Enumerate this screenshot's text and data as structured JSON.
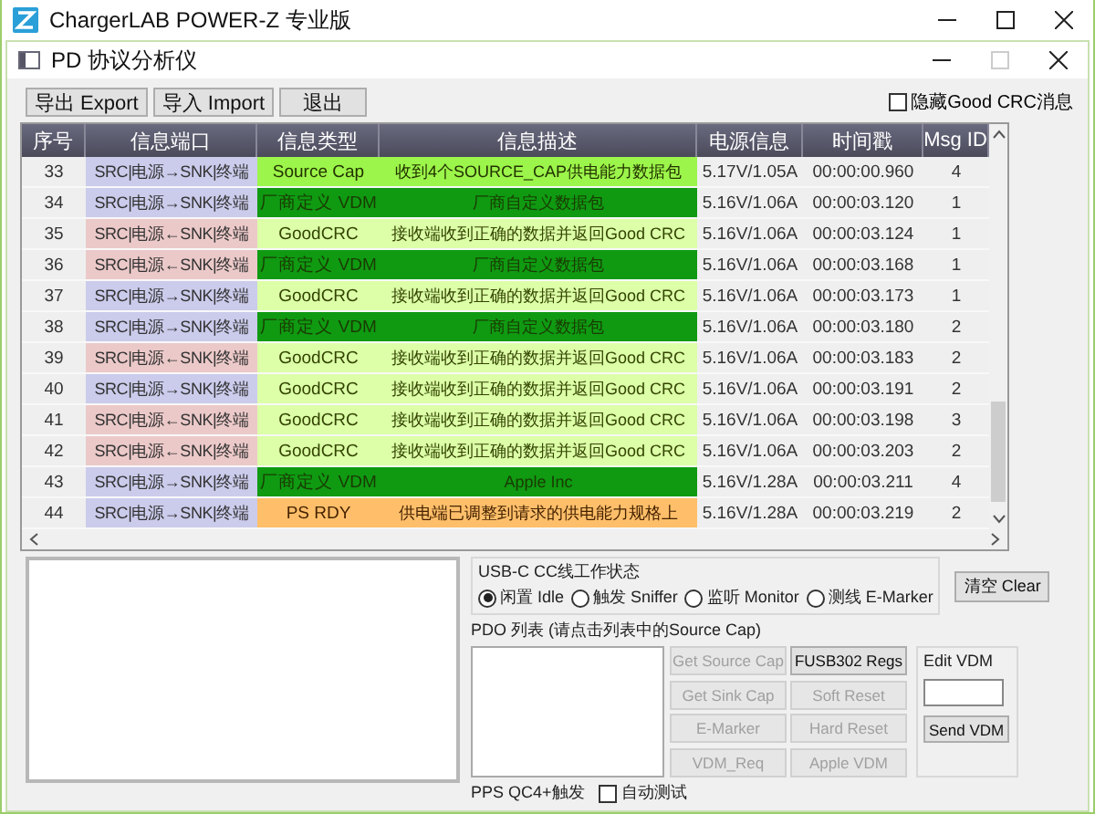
{
  "app_window": {
    "title": "ChargerLAB POWER-Z 专业版"
  },
  "dialog": {
    "title": "PD 协议分析仪"
  },
  "toolbar": {
    "buttons": [
      "导出 Export",
      "导入 Import",
      "退出"
    ],
    "hide_crc": {
      "label": "隐藏Good CRC消息",
      "checked": false
    }
  },
  "table": {
    "columns": [
      "序号",
      "信息端口",
      "信息类型",
      "信息描述",
      "电源信息",
      "时间戳",
      "Msg ID"
    ],
    "rows": [
      {
        "no": "33",
        "port": "SRC|电源→SNK|终端",
        "color": "#cbcbec",
        "type": "Source Cap",
        "kind": "cap",
        "desc": "收到4个SOURCE_CAP供电能力数据包",
        "power": "5.17V/1.05A",
        "time": "00:00:00.960",
        "msg_id": "4"
      },
      {
        "no": "34",
        "port": "SRC|电源→SNK|终端",
        "color": "#cbcbec",
        "type": "厂商定义 VDM",
        "kind": "vdm",
        "desc": "厂商自定义数据包",
        "power": "5.16V/1.06A",
        "time": "00:00:03.120",
        "msg_id": "1"
      },
      {
        "no": "35",
        "port": "SRC|电源←SNK|终端",
        "color": "#ecc9c9",
        "type": "GoodCRC",
        "kind": "crc",
        "desc": "接收端收到正确的数据并返回Good CRC",
        "power": "5.16V/1.06A",
        "time": "00:00:03.124",
        "msg_id": "1"
      },
      {
        "no": "36",
        "port": "SRC|电源←SNK|终端",
        "color": "#ecc9c9",
        "type": "厂商定义 VDM",
        "kind": "vdm",
        "desc": "厂商自定义数据包",
        "power": "5.16V/1.06A",
        "time": "00:00:03.168",
        "msg_id": "1"
      },
      {
        "no": "37",
        "port": "SRC|电源→SNK|终端",
        "color": "#cbcbec",
        "type": "GoodCRC",
        "kind": "crc",
        "desc": "接收端收到正确的数据并返回Good CRC",
        "power": "5.16V/1.06A",
        "time": "00:00:03.173",
        "msg_id": "1"
      },
      {
        "no": "38",
        "port": "SRC|电源→SNK|终端",
        "color": "#cbcbec",
        "type": "厂商定义 VDM",
        "kind": "vdm",
        "desc": "厂商自定义数据包",
        "power": "5.16V/1.06A",
        "time": "00:00:03.180",
        "msg_id": "2"
      },
      {
        "no": "39",
        "port": "SRC|电源←SNK|终端",
        "color": "#ecc9c9",
        "type": "GoodCRC",
        "kind": "crc",
        "desc": "接收端收到正确的数据并返回Good CRC",
        "power": "5.16V/1.06A",
        "time": "00:00:03.183",
        "msg_id": "2"
      },
      {
        "no": "40",
        "port": "SRC|电源→SNK|终端",
        "color": "#cbcbec",
        "type": "GoodCRC",
        "kind": "crc",
        "desc": "接收端收到正确的数据并返回Good CRC",
        "power": "5.16V/1.06A",
        "time": "00:00:03.191",
        "msg_id": "2"
      },
      {
        "no": "41",
        "port": "SRC|电源←SNK|终端",
        "color": "#ecc9c9",
        "type": "GoodCRC",
        "kind": "crc",
        "desc": "接收端收到正确的数据并返回Good CRC",
        "power": "5.16V/1.06A",
        "time": "00:00:03.198",
        "msg_id": "3"
      },
      {
        "no": "42",
        "port": "SRC|电源←SNK|终端",
        "color": "#ecc9c9",
        "type": "GoodCRC",
        "kind": "crc",
        "desc": "接收端收到正确的数据并返回Good CRC",
        "power": "5.16V/1.06A",
        "time": "00:00:03.203",
        "msg_id": "2"
      },
      {
        "no": "43",
        "port": "SRC|电源→SNK|终端",
        "color": "#cbcbec",
        "type": "厂商定义 VDM",
        "kind": "vdm",
        "desc": "Apple Inc",
        "power": "5.16V/1.28A",
        "time": "00:00:03.211",
        "msg_id": "4"
      },
      {
        "no": "44",
        "port": "SRC|电源→SNK|终端",
        "color": "#cbcbec",
        "type": "PS RDY",
        "kind": "rdy",
        "desc": "供电端已调整到请求的供电能力规格上",
        "power": "5.16V/1.28A",
        "time": "00:00:03.219",
        "msg_id": "2"
      }
    ]
  },
  "cc_state": {
    "title": "USB-C CC线工作状态",
    "options": [
      {
        "label": "闲置 Idle",
        "selected": true
      },
      {
        "label": "触发 Sniffer",
        "selected": false
      },
      {
        "label": "监听 Monitor",
        "selected": false
      },
      {
        "label": "测线 E-Marker",
        "selected": false
      }
    ]
  },
  "clear_button": "清空 Clear",
  "pdo": {
    "title": "PDO 列表 (请点击列表中的Source Cap)",
    "buttons": [
      {
        "label": "Get Source Cap",
        "disabled": true
      },
      {
        "label": "FUSB302 Regs",
        "disabled": false
      },
      {
        "label": "Get Sink Cap",
        "disabled": true
      },
      {
        "label": "Soft Reset",
        "disabled": true
      },
      {
        "label": "E-Marker",
        "disabled": true
      },
      {
        "label": "Hard Reset",
        "disabled": true
      },
      {
        "label": "VDM_Req",
        "disabled": true
      },
      {
        "label": "Apple VDM",
        "disabled": true
      }
    ]
  },
  "edit_vdm": {
    "title": "Edit VDM",
    "button": "Send VDM"
  },
  "pps": {
    "label": "PPS QC4+触发",
    "auto_test": {
      "label": "自动测试",
      "checked": false
    }
  }
}
